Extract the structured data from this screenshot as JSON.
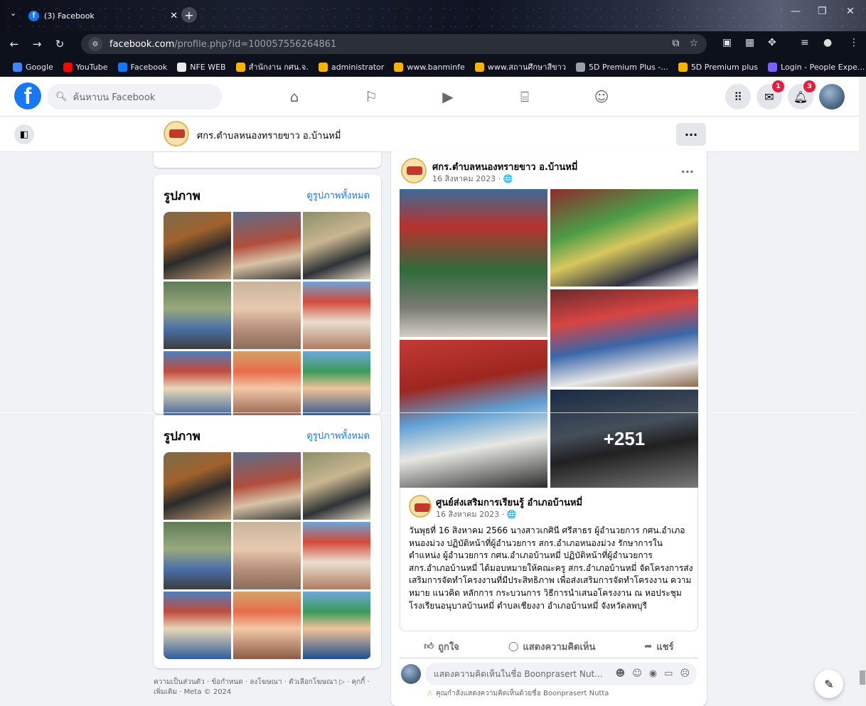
{
  "browser": {
    "tab_title": "(3) Facebook",
    "url_host": "facebook.com",
    "url_path": "/profile.php?id=100057556264861",
    "bookmarks": [
      {
        "label": "Google",
        "color": "#4285f4"
      },
      {
        "label": "YouTube",
        "color": "#ff0000"
      },
      {
        "label": "Facebook",
        "color": "#1877f2"
      },
      {
        "label": "NFE WEB",
        "color": "#e8eaed"
      },
      {
        "label": "สำนักงาน กศน.จ.",
        "color": "#f4b400"
      },
      {
        "label": "administrator",
        "color": "#f4b400"
      },
      {
        "label": "www.banminfe",
        "color": "#f4b400"
      },
      {
        "label": "www.สถานศึกษาสีขาว",
        "color": "#f4b400"
      },
      {
        "label": "5D Premium Plus -...",
        "color": "#9aa0a6"
      },
      {
        "label": "5D Premium plus",
        "color": "#f4b400"
      },
      {
        "label": "Login - People Expe...",
        "color": "#7b61ff"
      }
    ],
    "more_bookmarks": "»"
  },
  "header": {
    "logo": "f",
    "search_placeholder": "ค้นหาบน Facebook",
    "messenger_badge": "1",
    "notifications_badge": "3"
  },
  "subheader": {
    "page_name": "ศกร.ตำบลหนองทรายขาว อ.บ้านหมี่",
    "more": "···"
  },
  "photos": {
    "title": "รูปภาพ",
    "see_all": "ดูรูปภาพทั้งหมด"
  },
  "footer": {
    "text": "ความเป็นส่วนตัว · ข้อกำหนด · ลงโฆษณา · ตัวเลือกโฆษณา ▷ · คุกกี้ · เพิ่มเติม · Meta © 2024"
  },
  "post": {
    "author": "ศกร.ตำบลหนองทรายขาว อ.บ้านหมี่",
    "date": "16 สิงหาคม 2023 · 🌐",
    "more": "···",
    "more_photos": "+251",
    "shared_author": "ศูนย์ส่งเสริมการเรียนรู้ อำเภอบ้านหมี่",
    "shared_date": "16 สิงหาคม 2023 · 🌐",
    "text": "วันพุธที่ 16 สิงหาคม 2566 นางสาวเกศินี ศรีสาธร ผู้อำนวยการ กศน.อำเภอหนองม่วง ปฏิบัติหน้าที่ผู้อำนวยการ สกร.อำเภอหนองม่วง รักษาการในตำแหน่ง ผู้อำนวยการ กศน.อำเภอบ้านหมี่ ปฏิบัติหน้าที่ผู้อำนวยการ สกร.อำเภอบ้านหมี่ ได้มอบหมายให้คณะครู สกร.อำเภอบ้านหมี่ จัดโครงการส่งเสริมการจัดทำโครงงานที่มีประสิทธิภาพ เพื่อส่งเสริมการจัดทำโครงงาน ความหมาย แนวคิด หลักการ กระบวนการ วิธีการนำเสนอโครงงาน ณ หอประชุมโรงเรียนอนุบาลบ้านหมี่ ตำบลเชียงงา อำเภอบ้านหมี่ จังหวัดลพบุรี",
    "like": "ถูกใจ",
    "comment": "แสดงความคิดเห็น",
    "share": "แชร์",
    "comment_placeholder": "แสดงความคิดเห็นในชื่อ Boonprasert Nut...",
    "warning": "คุณกำลังแสดงความคิดเห็นด้วยชื่อ Boonprasert Nutta"
  }
}
